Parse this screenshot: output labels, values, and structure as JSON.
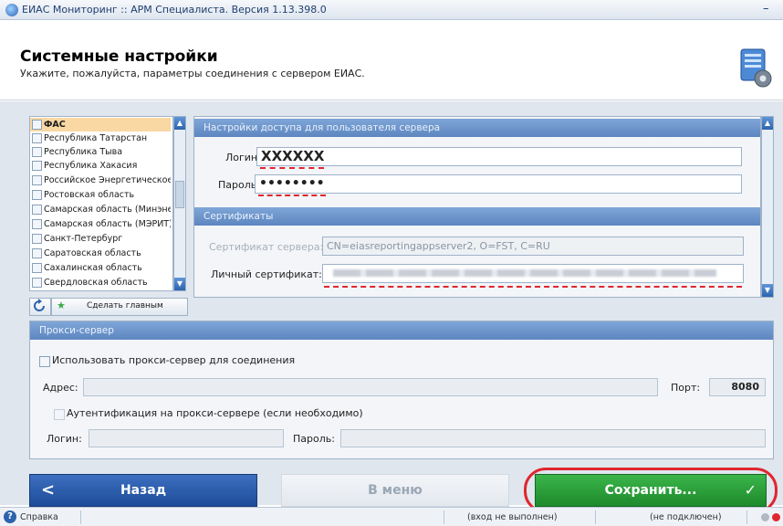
{
  "window": {
    "title": "ЕИАС Мониторинг :: АРМ Специалиста. Версия 1.13.398.0",
    "minimize_glyph": "–"
  },
  "header": {
    "title": "Системные настройки",
    "subtitle": "Укажите, пожалуйста, параметры соединения с сервером ЕИАС.",
    "icon": "server-settings-icon"
  },
  "region_list": {
    "items": [
      {
        "label": "ФАС",
        "selected": true
      },
      {
        "label": "Республика Татарстан"
      },
      {
        "label": "Республика Тыва"
      },
      {
        "label": "Республика Хакасия"
      },
      {
        "label": "Российское Энергетическое Аг"
      },
      {
        "label": "Ростовская область"
      },
      {
        "label": "Самарская область (Минэнерго"
      },
      {
        "label": "Самарская область (МЭРИТ)"
      },
      {
        "label": "Санкт-Петербург"
      },
      {
        "label": "Саратовская область"
      },
      {
        "label": "Сахалинская область"
      },
      {
        "label": "Свердловская область"
      }
    ],
    "refresh_icon": "refresh-icon",
    "star_icon": "star-icon",
    "make_main_label": "Сделать главным"
  },
  "access": {
    "section_title": "Настройки доступа для пользователя сервера",
    "login_label": "Логин:",
    "login_value": "XXXXXX",
    "password_label": "Пароль:",
    "password_value": "••••••••"
  },
  "certificates": {
    "section_title": "Сертификаты",
    "server_cert_label": "Сертификат сервера:",
    "server_cert_value": "CN=eiasreportingappserver2, O=FST, C=RU",
    "personal_cert_label": "Личный сертификат:",
    "personal_cert_value": ""
  },
  "proxy": {
    "section_title": "Прокси-сервер",
    "use_proxy_label": "Использовать прокси-сервер для соединения",
    "address_label": "Адрес:",
    "address_value": "",
    "port_label": "Порт:",
    "port_value": "8080",
    "auth_label": "Аутентификация на прокси-сервере (если необходимо)",
    "login_label": "Логин:",
    "login_value": "",
    "password_label": "Пароль:",
    "password_value": ""
  },
  "buttons": {
    "back_label": "Назад",
    "back_arrow": "<",
    "menu_label": "В меню",
    "save_label": "Сохранить...",
    "save_check": "✓"
  },
  "status": {
    "help_label": "Справка",
    "login_state": "(вход не выполнен)",
    "connection_state": "(не подключен)"
  },
  "colors": {
    "accent_blue": "#2d63ad",
    "save_green": "#1e8a2d",
    "highlight_red": "#e0262f"
  }
}
